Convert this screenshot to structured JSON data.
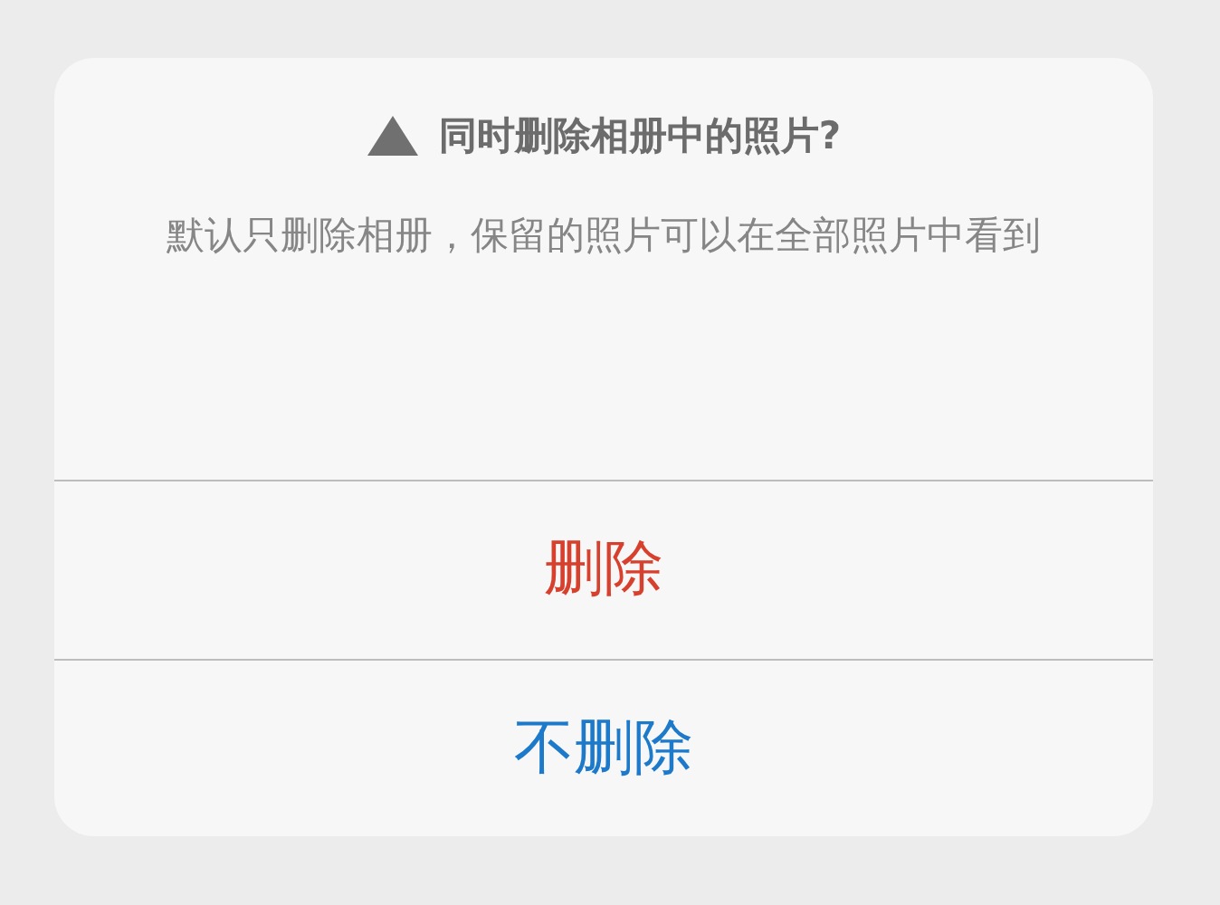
{
  "dialog": {
    "title": "同时删除相册中的照片?",
    "message": "默认只删除相册，保留的照片可以在全部照片中看到",
    "buttons": [
      {
        "label": "删除",
        "kind": "destructive"
      },
      {
        "label": "不删除",
        "kind": "default"
      }
    ]
  }
}
